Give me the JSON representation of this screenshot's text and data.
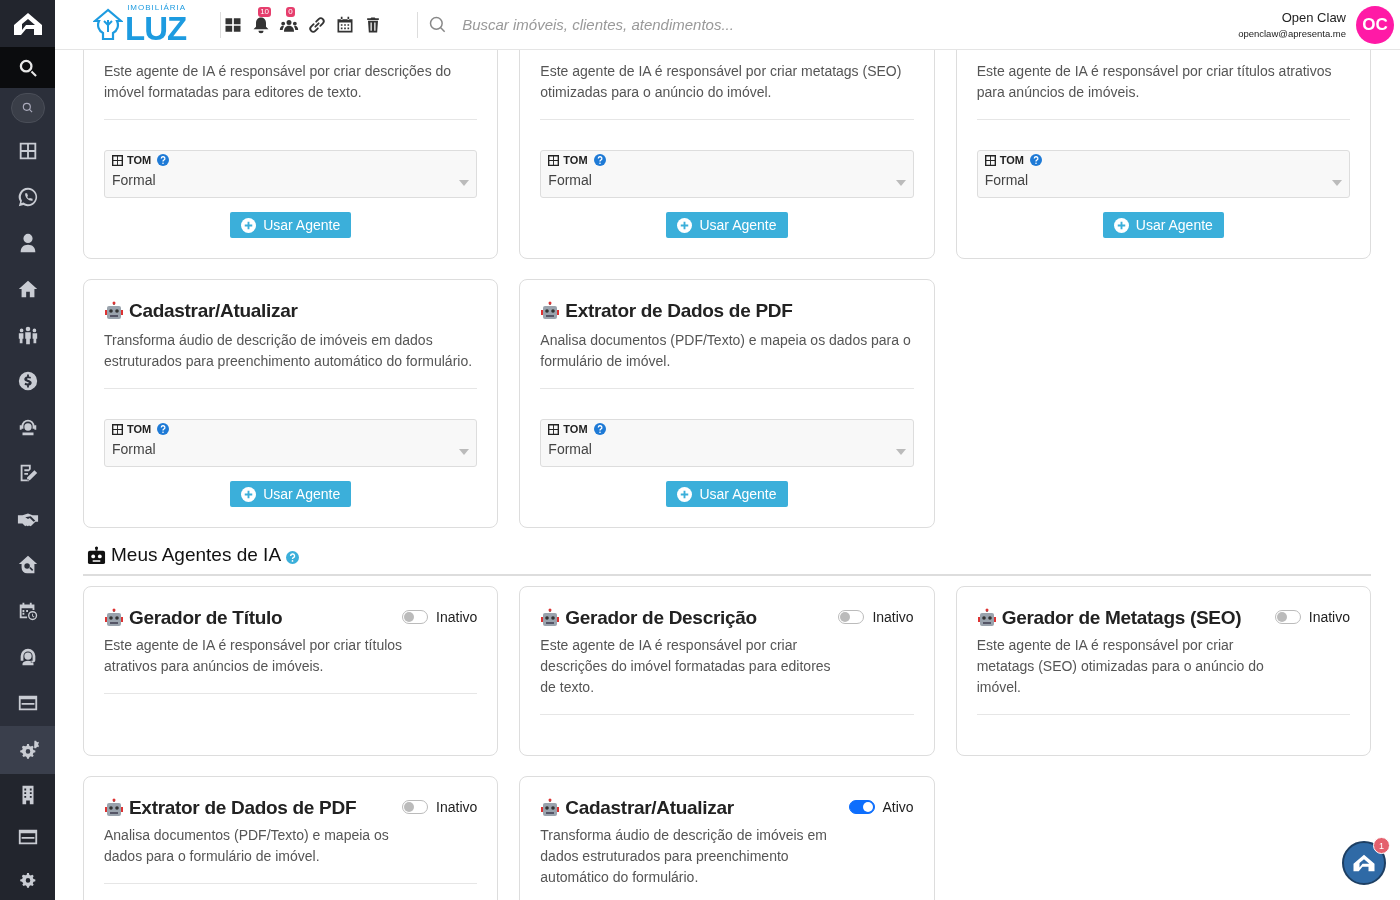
{
  "header": {
    "brand_small": "IMOBILIÁRIA",
    "brand": "LUZ",
    "notifications_badge": "10",
    "team_badge": "0",
    "search": {
      "placeholder": "Buscar imóveis, clientes, atendimentos..."
    },
    "user": {
      "name": "Open Claw",
      "email": "openclaw@apresenta.me",
      "initials": "OC"
    }
  },
  "agent_templates": [
    {
      "description": "Este agente de IA é responsável por criar descrições do imóvel formatadas para editores de texto.",
      "field_label": "TOM",
      "field_value": "Formal",
      "button": "Usar Agente"
    },
    {
      "description": "Este agente de IA é responsável por criar metatags (SEO) otimizadas para o anúncio do imóvel.",
      "field_label": "TOM",
      "field_value": "Formal",
      "button": "Usar Agente"
    },
    {
      "description": "Este agente de IA é responsável por criar títulos atrativos para anúncios de imóveis.",
      "field_label": "TOM",
      "field_value": "Formal",
      "button": "Usar Agente"
    },
    {
      "title": "Cadastrar/Atualizar",
      "description": "Transforma áudio de descrição de imóveis em dados estruturados para preenchimento automático do formulário.",
      "field_label": "TOM",
      "field_value": "Formal",
      "button": "Usar Agente"
    },
    {
      "title": "Extrator de Dados de PDF",
      "description": "Analisa documentos (PDF/Texto) e mapeia os dados para o formulário de imóvel.",
      "field_label": "TOM",
      "field_value": "Formal",
      "button": "Usar Agente"
    }
  ],
  "my_agents_section": {
    "title": "Meus Agentes de IA"
  },
  "my_agents": [
    {
      "title": "Gerador de Título",
      "description": "Este agente de IA é responsável por criar títulos atrativos para anúncios de imóveis.",
      "active": false,
      "status": "Inativo"
    },
    {
      "title": "Gerador de Descrição",
      "description": "Este agente de IA é responsável por criar descrições do imóvel formatadas para editores de texto.",
      "active": false,
      "status": "Inativo"
    },
    {
      "title": "Gerador de Metatags (SEO)",
      "description": "Este agente de IA é responsável por criar metatags (SEO) otimizadas para o anúncio do imóvel.",
      "active": false,
      "status": "Inativo"
    },
    {
      "title": "Extrator de Dados de PDF",
      "description": "Analisa documentos (PDF/Texto) e mapeia os dados para o formulário de imóvel.",
      "active": false,
      "status": "Inativo"
    },
    {
      "title": "Cadastrar/Atualizar",
      "description": "Transforma áudio de descrição de imóveis em dados estruturados para preenchimento automático do formulário.",
      "active": true,
      "status": "Ativo"
    }
  ],
  "chat_badge": "1"
}
